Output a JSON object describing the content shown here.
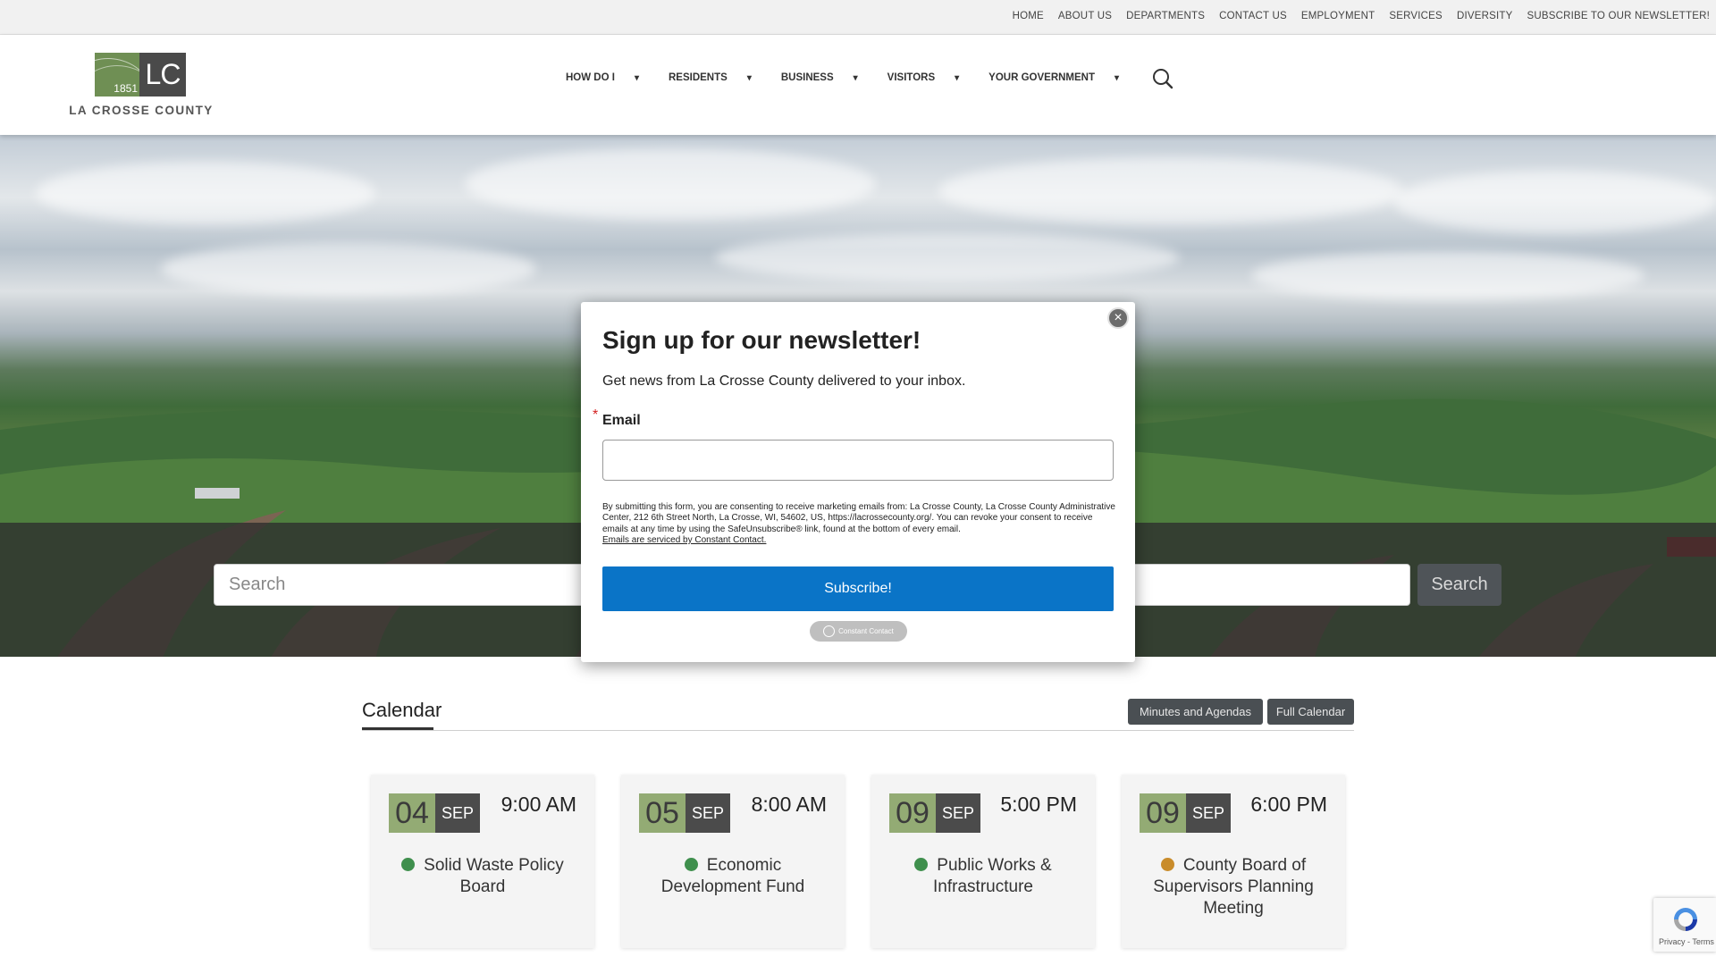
{
  "utility_nav": {
    "links": [
      "HOME",
      "ABOUT US",
      "DEPARTMENTS",
      "CONTACT US",
      "EMPLOYMENT",
      "SERVICES",
      "DIVERSITY",
      "SUBSCRIBE TO OUR NEWSLETTER!"
    ]
  },
  "logo": {
    "initials": "LC",
    "year": "1851",
    "name": "LA CROSSE COUNTY",
    "colors": {
      "green": "#6f8f54",
      "dark": "#4a4a4a"
    }
  },
  "main_nav": {
    "items": [
      "HOW DO I",
      "RESIDENTS",
      "BUSINESS",
      "VISITORS",
      "YOUR GOVERNMENT"
    ],
    "caret": "▾",
    "search_icon": "search-icon"
  },
  "hero": {
    "search_placeholder": "Search",
    "search_button": "Search"
  },
  "calendar": {
    "title": "Calendar",
    "buttons": {
      "minutes": "Minutes and Agendas",
      "full": "Full Calendar"
    },
    "events": [
      {
        "day": "04",
        "month": "SEP",
        "time": "9:00 AM",
        "title": "Solid Waste Policy Board",
        "dot_color": "#3f8f4d"
      },
      {
        "day": "05",
        "month": "SEP",
        "time": "8:00 AM",
        "title": "Economic Development Fund",
        "dot_color": "#3f8f4d"
      },
      {
        "day": "09",
        "month": "SEP",
        "time": "5:00 PM",
        "title": "Public Works & Infrastructure",
        "dot_color": "#3f8f4d"
      },
      {
        "day": "09",
        "month": "SEP",
        "time": "6:00 PM",
        "title": "County Board of Supervisors Planning Meeting",
        "dot_color": "#c98c2b"
      }
    ]
  },
  "modal": {
    "title": "Sign up for our newsletter!",
    "subtitle": "Get news from La Crosse County delivered to your inbox.",
    "required_mark": "*",
    "email_label": "Email",
    "email_value": "",
    "legal_text": "By submitting this form, you are consenting to receive marketing emails from: La Crosse County, La Crosse County Administrative Center, 212 6th Street North, La Crosse, WI, 54602, US, https://lacrossecounty.org/. You can revoke your consent to receive emails at any time by using the SafeUnsubscribe® link, found at the bottom of every email.",
    "legal_link": "Emails are serviced by Constant Contact.",
    "submit_label": "Subscribe!",
    "badge_label": "Constant Contact",
    "close_glyph": "×",
    "accent_color": "#0a74c7"
  },
  "recaptcha": {
    "terms": "Privacy - Terms"
  }
}
